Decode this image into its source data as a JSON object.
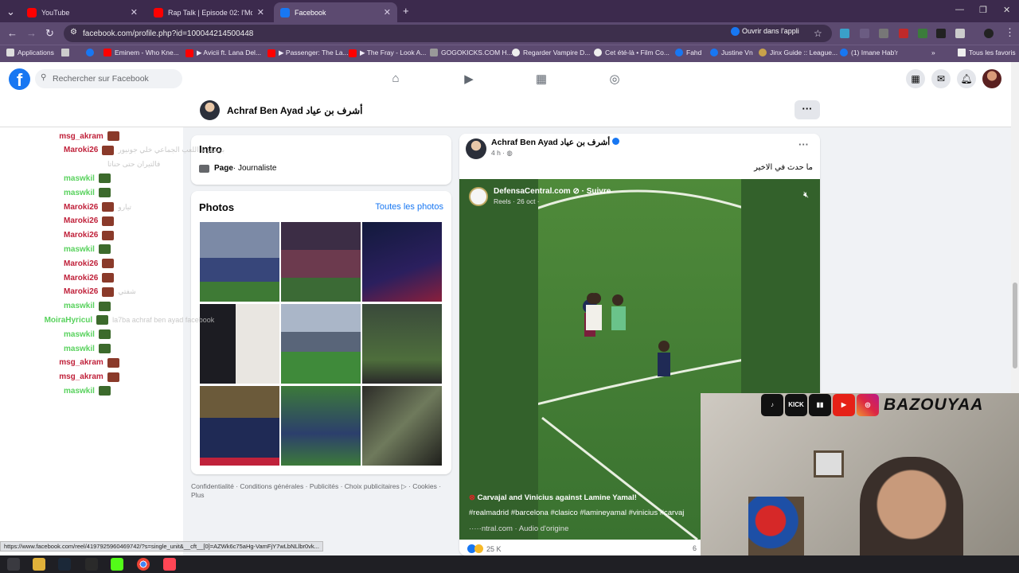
{
  "tabs": [
    {
      "title": "YouTube",
      "favicon_color": "#ff0000"
    },
    {
      "title": "Rap Talk | Episode 02: l'Morphi",
      "favicon_color": "#ff0000"
    },
    {
      "title": "Facebook",
      "favicon_color": "#1877f2"
    }
  ],
  "address": {
    "url": "facebook.com/profile.php?id=100044214500448",
    "open_app": "Ouvrir dans l'appli"
  },
  "bookmarks": [
    {
      "label": "Applications",
      "color": "#ddd"
    },
    {
      "label": "Eminem - Who Kne...",
      "color": "#ff0000"
    },
    {
      "label": "▶ Avicii ft. Lana Del...",
      "color": "#ff0000"
    },
    {
      "label": "▶ Passenger: The La...",
      "color": "#ff0000"
    },
    {
      "label": "▶ The Fray - Look A...",
      "color": "#ff0000"
    },
    {
      "label": "GOGOKICKS.COM H...",
      "color": "#999"
    },
    {
      "label": "Regarder Vampire D...",
      "color": "#eee"
    },
    {
      "label": "Cet été-là • Film Co...",
      "color": "#eee"
    },
    {
      "label": "Fahd",
      "color": "#1877f2"
    },
    {
      "label": "Justine Vn",
      "color": "#1877f2"
    },
    {
      "label": "Jinx Guide :: League...",
      "color": "#c8a24a"
    },
    {
      "label": "(1) Imane Hab'r",
      "color": "#1877f2"
    },
    {
      "label": "Tous les favoris",
      "color": "#eee"
    }
  ],
  "fb": {
    "search_placeholder": "Rechercher sur Facebook",
    "profile_name": "Achraf Ben Ayad أشرف بن عياد",
    "intro_title": "Intro",
    "intro_page": "Page",
    "intro_category": " · Journaliste",
    "photos_title": "Photos",
    "photos_all": "Toutes les photos",
    "footer": "Confidentialité · Conditions générales · Publicités · Choix publicitaires ▷ · Cookies · Plus"
  },
  "chat": [
    {
      "user": "msg_akram",
      "color": "#c0223b",
      "msg": ""
    },
    {
      "user": "Maroki26",
      "color": "#c0223b",
      "msg": "ﺑﺮﺷﻠﻮﻧﺔ ﺍﻟﻠﻌﺐ ﺍﻟﺠﻤﺎﻋﻲ ﺧﻠﻲ ﺟﻮﻧﻴﻮﺭ"
    },
    {
      "user": "",
      "color": "#c0223b",
      "msg": "ﻓﺎﻟﺘﻴﺮﺍﻥ ﺣﺘﻰ ﺣﻨﺎﺗﺎ"
    },
    {
      "user": "maswkil",
      "color": "#58d25d",
      "msg": ""
    },
    {
      "user": "maswkil",
      "color": "#58d25d",
      "msg": ""
    },
    {
      "user": "Maroki26",
      "color": "#c0223b",
      "msg": "ﺗﻴﺎﺭﻭ"
    },
    {
      "user": "Maroki26",
      "color": "#c0223b",
      "msg": ""
    },
    {
      "user": "Maroki26",
      "color": "#c0223b",
      "msg": ""
    },
    {
      "user": "maswkil",
      "color": "#58d25d",
      "msg": ""
    },
    {
      "user": "Maroki26",
      "color": "#c0223b",
      "msg": ""
    },
    {
      "user": "Maroki26",
      "color": "#c0223b",
      "msg": ""
    },
    {
      "user": "Maroki26",
      "color": "#c0223b",
      "msg": "ﺷﻔﺘﻲ"
    },
    {
      "user": "maswkil",
      "color": "#58d25d",
      "msg": ""
    },
    {
      "user": "MoiraHyricul",
      "color": "#58d25d",
      "msg": "la7ba achraf ben ayad facebook"
    },
    {
      "user": "maswkil",
      "color": "#58d25d",
      "msg": ""
    },
    {
      "user": "maswkil",
      "color": "#58d25d",
      "msg": ""
    },
    {
      "user": "msg_akram",
      "color": "#c0223b",
      "msg": ""
    },
    {
      "user": "msg_akram",
      "color": "#c0223b",
      "msg": ""
    },
    {
      "user": "maswkil",
      "color": "#58d25d",
      "msg": ""
    }
  ],
  "post": {
    "author": "Achraf Ben Ayad أشرف بن عياد",
    "time": "4 h · ",
    "text": "ما حدث في الاخير",
    "reel_source": "DefensaCentral.com ⊘ · Suivre",
    "reel_date": "Reels · 26 oct · ",
    "caption": "Carvajal and Vinicius against Lamine Yamal!",
    "hashtags": "#realmadrid #barcelona #clasico #lamineyamal #vinicius #carvaj",
    "audio": "·····ntral.com · Audio d'origine",
    "reactions": "25 K",
    "comments_partial": "6"
  },
  "status_url": "https://www.facebook.com/reel/4197925960469742/?s=single_unit&__cft__[0]=AZWk6c75aHg-VamFjY7wLbNLlbr0vk...",
  "stream": {
    "handle": "BAZOUYAA",
    "kick": "KICK"
  }
}
